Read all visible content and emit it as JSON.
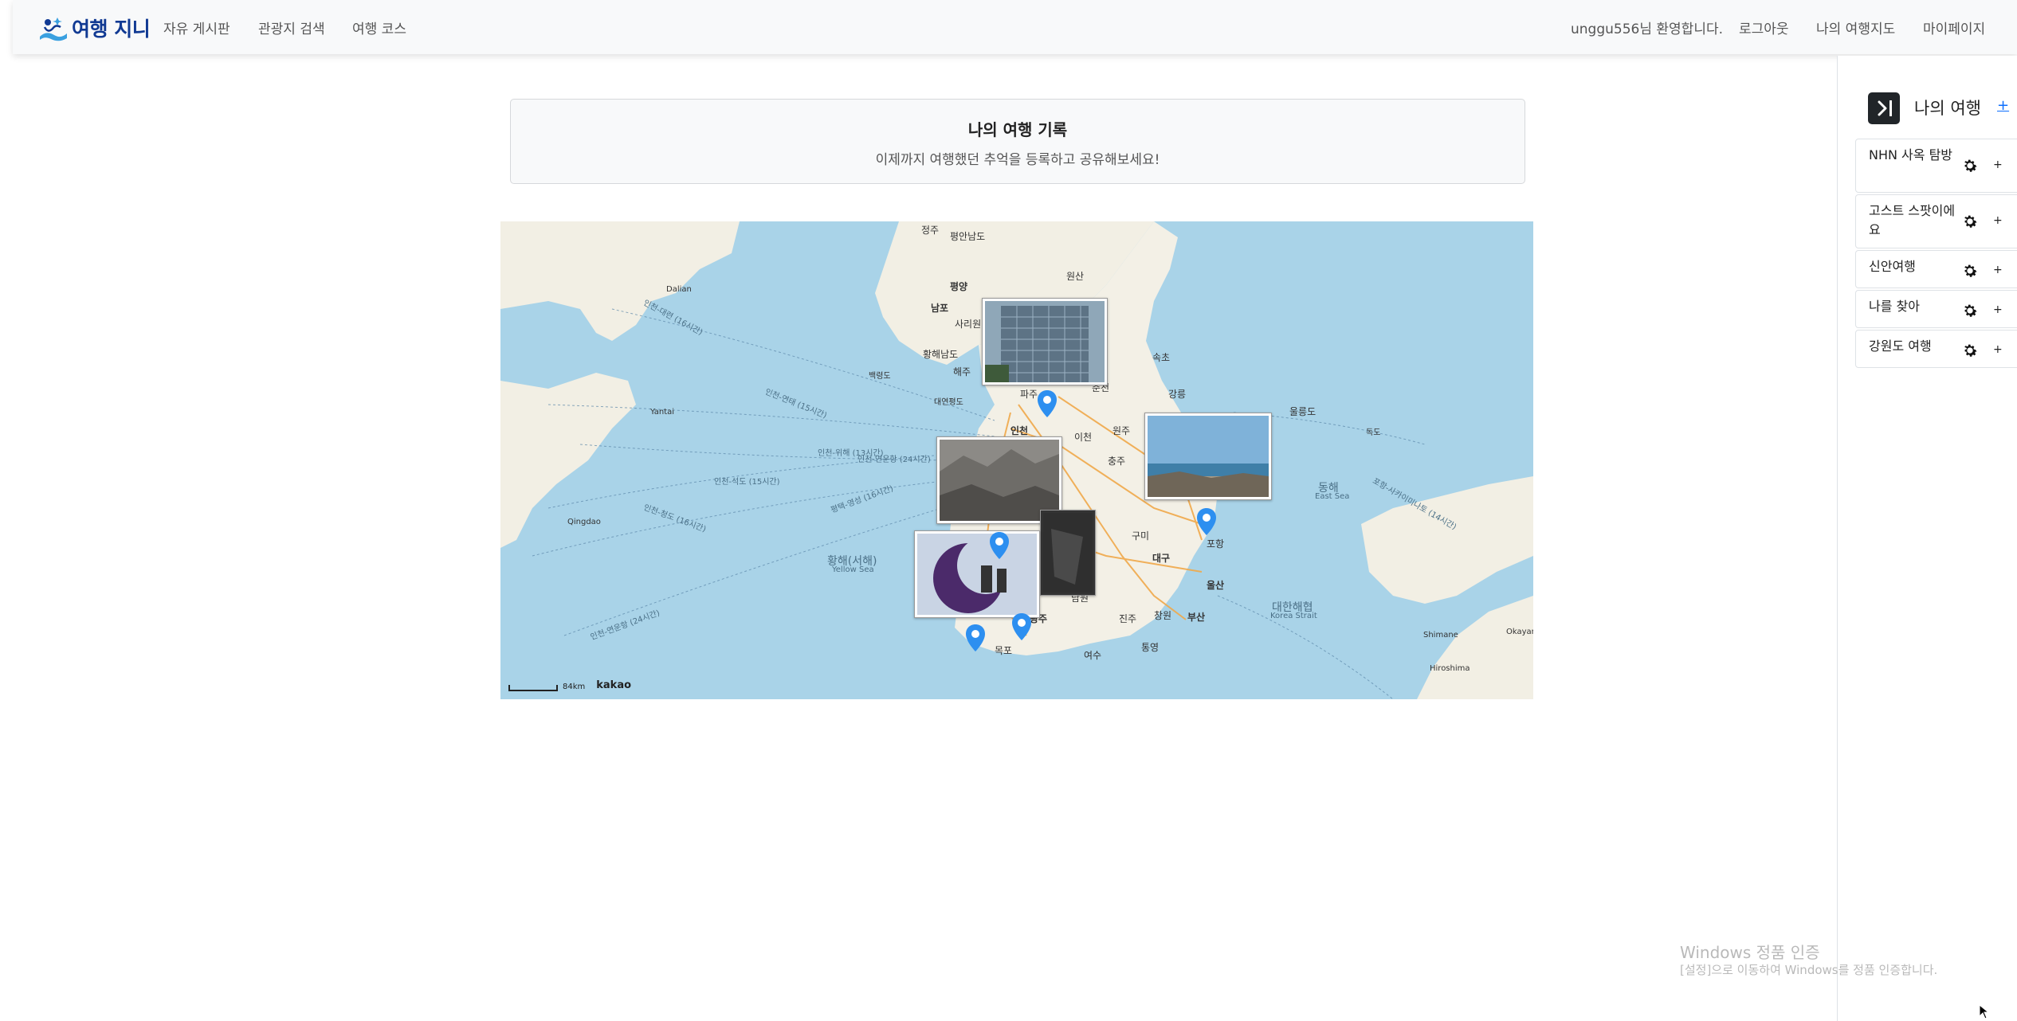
{
  "nav": {
    "brand": "여행 지니",
    "links": [
      "자유 게시판",
      "관광지 검색",
      "여행 코스"
    ],
    "welcome": "unggu556님 환영합니다.",
    "logout": "로그아웃",
    "my_travel_map": "나의 여행지도",
    "mypage": "마이페이지"
  },
  "header": {
    "title": "나의 여행 기록",
    "subtitle": "이제까지 여행했던 추억을 등록하고 공유해보세요!"
  },
  "map": {
    "attribution": "kakao",
    "scale": "84km",
    "cities": [
      "정주",
      "평안남도",
      "평양",
      "남포",
      "사리원",
      "황해남도",
      "해주",
      "백령도",
      "대연평도",
      "파주",
      "인천",
      "원산",
      "속초",
      "강릉",
      "춘천",
      "원주",
      "이천",
      "충주",
      "구미",
      "대구",
      "포항",
      "울산",
      "부산",
      "창원",
      "진주",
      "여수",
      "목포",
      "광주",
      "남원",
      "통영",
      "울릉도",
      "독도",
      "Dalian",
      "Yantai",
      "Qingdao",
      "Shimane",
      "Okayama",
      "Hiroshima"
    ],
    "seas": {
      "yellow_sea_ko": "황해(서해)",
      "yellow_sea_en": "Yellow Sea",
      "east_sea_ko": "동해",
      "east_sea_en": "East Sea",
      "strait_ko": "대한해협",
      "strait_en": "Korea Strait"
    },
    "ferry_routes": [
      "인천-대련 (16시간)",
      "인천-위해 (13시간)",
      "인천-연운항 (24시간)",
      "인천-석도 (15시간)",
      "인천-청도 (16시간)",
      "인천-연태 (15시간)",
      "평택-영성 (16시간)",
      "인천-연운항 (24시간)",
      "포항-사카이미나토 (14시간)"
    ]
  },
  "sidebar": {
    "title": "나의 여행",
    "add": "+",
    "trips": [
      {
        "name": "NHN 사옥 탐방",
        "plus": "+"
      },
      {
        "name": "고스트 스팟이에요",
        "plus": "+"
      },
      {
        "name": "신안여행",
        "plus": "+"
      },
      {
        "name": "나를 찾아",
        "plus": "+"
      },
      {
        "name": "강원도 여행",
        "plus": "+"
      }
    ]
  },
  "watermark": {
    "title": "Windows 정품 인증",
    "subtitle": "[설정]으로 이동하여 Windows를 정품 인증합니다."
  },
  "colors": {
    "brand": "#113a93",
    "sea": "#a9d3e8",
    "land": "#f2efe4",
    "pin": "#2d8ff0",
    "accent": "#0d6efd"
  }
}
